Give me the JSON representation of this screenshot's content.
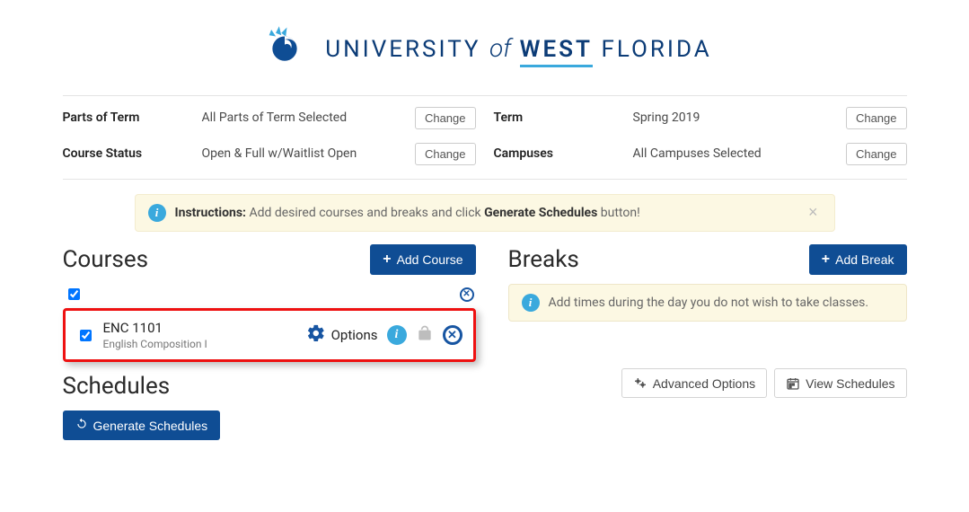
{
  "logo": {
    "text_prefix": "UNIVERSITY",
    "of": "of",
    "west": "WEST",
    "suffix": "FLORIDA"
  },
  "filters": {
    "parts_of_term": {
      "label": "Parts of Term",
      "value": "All Parts of Term Selected",
      "change": "Change"
    },
    "course_status": {
      "label": "Course Status",
      "value": "Open & Full w/Waitlist Open",
      "change": "Change"
    },
    "term": {
      "label": "Term",
      "value": "Spring 2019",
      "change": "Change"
    },
    "campuses": {
      "label": "Campuses",
      "value": "All Campuses Selected",
      "change": "Change"
    }
  },
  "instructions": {
    "label": "Instructions:",
    "text1": "Add desired courses and breaks and click ",
    "emph": "Generate Schedules",
    "text2": " button!"
  },
  "courses": {
    "title": "Courses",
    "add_label": "Add Course",
    "item": {
      "code": "ENC 1101",
      "name": "English Composition I",
      "options_label": "Options"
    }
  },
  "breaks": {
    "title": "Breaks",
    "add_label": "Add Break",
    "hint": "Add times during the day you do not wish to take classes."
  },
  "schedules": {
    "title": "Schedules",
    "advanced": "Advanced Options",
    "view": "View Schedules",
    "generate": "Generate Schedules"
  }
}
